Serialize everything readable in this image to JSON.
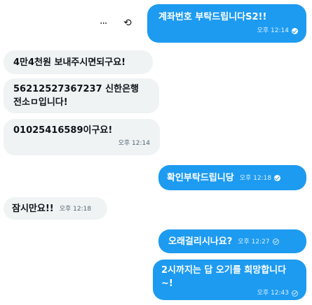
{
  "toolbar": {
    "more_glyph": "···",
    "react_glyph": "⟲"
  },
  "messages": [
    {
      "text": "계좌번호 부탁드립니다S2!!",
      "time": "오후 12:14",
      "status": "read"
    },
    {
      "text": "4만4천원 보내주시면되구요!"
    },
    {
      "text": "56212527367237 신한은행 전소ㅁ입니다!"
    },
    {
      "text": "01025416589이구요!",
      "time": "오후 12:14"
    },
    {
      "text": "확인부탁드립니당",
      "time": "오후 12:18",
      "status": "read"
    },
    {
      "text": "잠시만요!!",
      "time": "오후 12:18"
    },
    {
      "text": "오래걸리시나요?",
      "time": "오후 12:27",
      "status": "sent"
    },
    {
      "text": "2시까지는 답 오기를 희망합니다~!",
      "time": "오후 12:43",
      "status": "sent"
    }
  ],
  "colors": {
    "outgoing": "#1d9bf0",
    "incoming": "#eff3f4"
  }
}
